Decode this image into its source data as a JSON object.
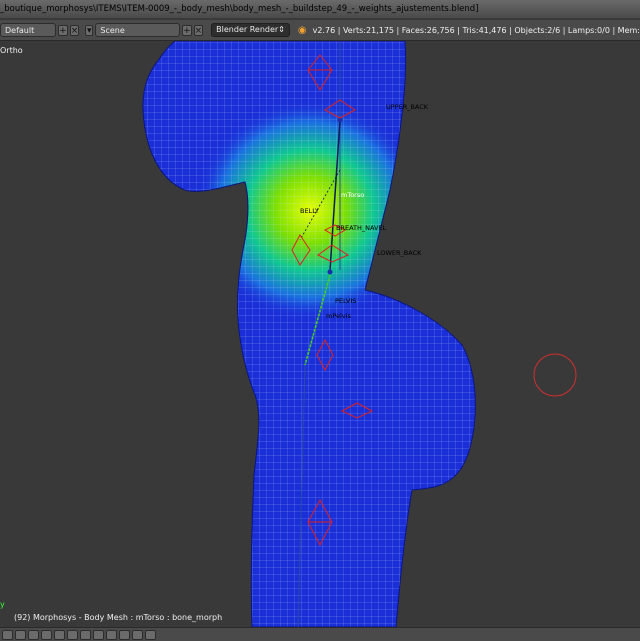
{
  "title_bar": {
    "path": "_boutique_morphosys\\ITEMS\\ITEM-0009_-_body_mesh\\body_mesh_-_buildstep_49_-_weights_ajustements.blend]"
  },
  "info_bar": {
    "screen_layout": "Default",
    "scene": "Scene",
    "render_engine": "Blender Render",
    "stats": "v2.76 | Verts:21,175 | Faces:26,756 | Tris:41,476 | Objects:2/6 | Lamps:0/0 | Mem:"
  },
  "viewport": {
    "projection_label": "Ortho",
    "status_text": "(92) Morphosys - Body Mesh : mTorso : bone_morph",
    "axis_label": "y",
    "bone_labels": {
      "upper_back": "UPPER_BACK",
      "mtorso": "mTorso",
      "belly": "BELLY",
      "breath_navel": "BREATH_NAVEL",
      "lower_back": "LOWER_BACK",
      "pelvis": "PELVIS",
      "mpelvis": "mPelvis"
    }
  },
  "colors": {
    "background": "#393939",
    "mesh_low_weight": "#1a2fd8",
    "mesh_high_weight": "#d8ff00",
    "bone_red": "#e02020",
    "cursor_red": "#d03030"
  }
}
